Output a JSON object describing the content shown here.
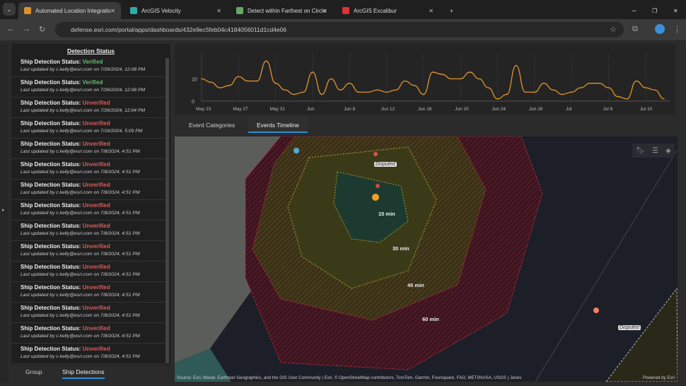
{
  "browser": {
    "tabs": [
      {
        "label": "Automated Location Integratio",
        "color": "#e0902a",
        "active": true
      },
      {
        "label": "ArcGIS Velocity",
        "color": "#3aa"
      },
      {
        "label": "Detect within Farthest on Circle",
        "color": "#6a6"
      },
      {
        "label": "ArcGIS Excalibur",
        "color": "#d33"
      }
    ],
    "url": "defense.esri.com/portal/apps/dashboards/432e9ec5feb04c4184056011d1cd4e06"
  },
  "list": {
    "title": "Detection Status",
    "prefix": "Ship Detection Status:",
    "items": [
      {
        "status": "Verified",
        "updated": "Last updated by c.kelly@esri.com on 7/26/2024, 12:08 PM"
      },
      {
        "status": "Verified",
        "updated": "Last updated by c.kelly@esri.com on 7/26/2024, 12:08 PM"
      },
      {
        "status": "Unverified",
        "updated": "Last updated by c.kelly@esri.com on 7/26/2024, 12:04 PM"
      },
      {
        "status": "Unverified",
        "updated": "Last updated by c.kelly@esri.com on 7/16/2024, 5:09 PM"
      },
      {
        "status": "Unverified",
        "updated": "Last updated by c.kelly@esri.com on 7/8/2024, 4:51 PM"
      },
      {
        "status": "Unverified",
        "updated": "Last updated by c.kelly@esri.com on 7/8/2024, 4:51 PM"
      },
      {
        "status": "Unverified",
        "updated": "Last updated by c.kelly@esri.com on 7/8/2024, 4:51 PM"
      },
      {
        "status": "Unverified",
        "updated": "Last updated by c.kelly@esri.com on 7/8/2024, 4:51 PM"
      },
      {
        "status": "Unverified",
        "updated": "Last updated by c.kelly@esri.com on 7/8/2024, 4:51 PM"
      },
      {
        "status": "Unverified",
        "updated": "Last updated by c.kelly@esri.com on 7/8/2024, 4:51 PM"
      },
      {
        "status": "Unverified",
        "updated": "Last updated by c.kelly@esri.com on 7/8/2024, 4:51 PM"
      },
      {
        "status": "Unverified",
        "updated": "Last updated by c.kelly@esri.com on 7/8/2024, 4:51 PM"
      },
      {
        "status": "Unverified",
        "updated": "Last updated by c.kelly@esri.com on 7/8/2024, 4:51 PM"
      },
      {
        "status": "Unverified",
        "updated": "Last updated by c.kelly@esri.com on 7/8/2024, 4:51 PM"
      },
      {
        "status": "Unverified",
        "updated": "Last updated by c.kelly@esri.com on 7/8/2024, 4:51 PM"
      }
    ]
  },
  "bottom_tabs": {
    "group": "Group",
    "ship": "Ship Detections"
  },
  "chart_tabs": {
    "categories": "Event Categories",
    "timeline": "Events Timeline"
  },
  "chart_data": {
    "type": "line",
    "color": "#e0952a",
    "ylim": [
      0,
      20
    ],
    "yticks": [
      0,
      10
    ],
    "xticklabels": [
      "May 23",
      "May 27",
      "May 31",
      "Jun",
      "Jun 8",
      "Jun 12",
      "Jun 16",
      "Jun 20",
      "Jun 24",
      "Jun 28",
      "Jul",
      "Jul 6",
      "Jul 10"
    ],
    "xtick_dates": [
      "2024-05-23",
      "2024-05-27",
      "2024-05-31",
      "2024-06-04",
      "2024-06-08",
      "2024-06-12",
      "2024-06-16",
      "2024-06-20",
      "2024-06-24",
      "2024-06-28",
      "2024-07-02",
      "2024-07-06",
      "2024-07-10"
    ],
    "start": "2024-05-23",
    "values": [
      10,
      8.5,
      6,
      7,
      11,
      9,
      9,
      18,
      8,
      5,
      3,
      4,
      13,
      3,
      10,
      5,
      8,
      4,
      4,
      5,
      4,
      5,
      9,
      7,
      3,
      13,
      12,
      10,
      10,
      13,
      10,
      6,
      1,
      3,
      16,
      4,
      4,
      8,
      5,
      3,
      4,
      6,
      8,
      8,
      6,
      2,
      1,
      9,
      6,
      5,
      1
    ]
  },
  "map": {
    "rings": [
      "15 min",
      "30 min",
      "45 min",
      "60 min"
    ],
    "disputed": "Disputed",
    "attribution": "Source: Esri, Maxar, Earthstar Geographics, and the GIS User Community | Esri, © OpenStreetMap contributors, TomTom, Garmin, Foursquare, FAO, METI/NASA, USGS | Janes",
    "powered": "Powered by Esri"
  }
}
